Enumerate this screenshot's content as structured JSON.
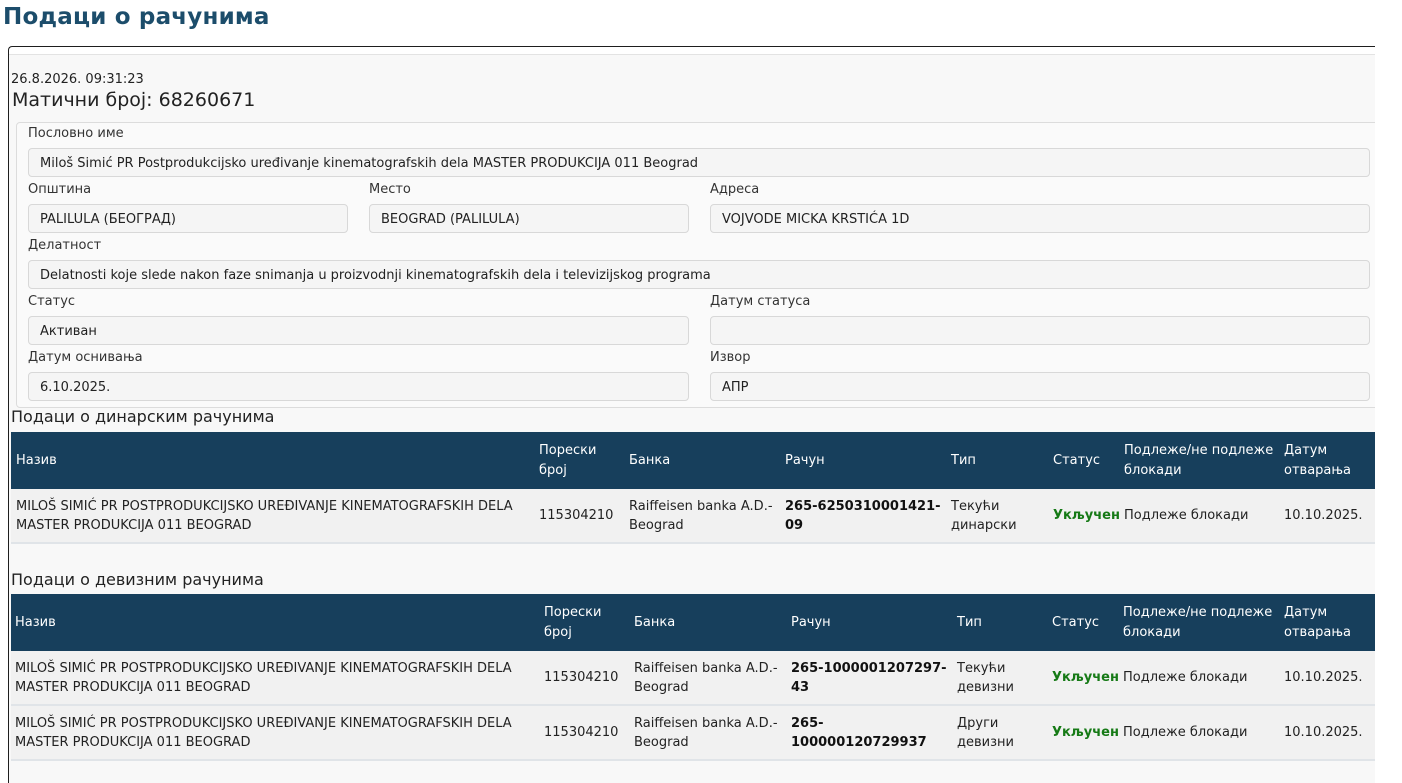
{
  "page": {
    "title": "Подаци о рачунима"
  },
  "meta": {
    "timestamp": "26.8.2026. 09:31:23",
    "maticni_label": "Матични број:",
    "maticni_value": "68260671"
  },
  "form": {
    "poslovno_ime_label": "Пословно име",
    "poslovno_ime": "Miloš Simić PR Postprodukcijsko uređivanje kinematografskih dela MASTER PRODUKCIJA 011 Beograd",
    "opstina_label": "Општина",
    "opstina": "PALILULA (БЕОГРАД)",
    "mesto_label": "Место",
    "mesto": "BEOGRAD (PALILULA)",
    "adresa_label": "Адреса",
    "adresa": "VOJVODE MICKA KRSTIĆA 1D",
    "delatnost_label": "Делатност",
    "delatnost": "Delatnosti koje slede nakon faze snimanja u proizvodnji kinematografskih dela i televizijskog programa",
    "status_label": "Статус",
    "status": "Активан",
    "datum_statusa_label": "Датум статуса",
    "datum_statusa": "",
    "datum_osnivanja_label": "Датум оснивања",
    "datum_osnivanja": "6.10.2025.",
    "izvor_label": "Извор",
    "izvor": "АПР"
  },
  "dinarski": {
    "title": "Подаци о динарским рачунима",
    "headers": [
      "Назив",
      "Порески број",
      "Банка",
      "Рачун",
      "Тип",
      "Статус",
      "Подлеже/не подлеже блокади",
      "Датум отварања"
    ],
    "rows": [
      {
        "naziv": "MILOŠ SIMIĆ PR POSTPRODUKCIJSKO UREĐIVANJE KINEMATOGRAFSKIH DELA MASTER PRODUKCIJA 011 BEOGRAD",
        "pib": "115304210",
        "banka": "Raiffeisen banka A.D.-Beograd",
        "racun": "265-6250310001421-09",
        "tip": "Текући динарски",
        "status": "Укључен",
        "blokada": "Подлеже блокади",
        "datum": "10.10.2025."
      }
    ]
  },
  "devizni": {
    "title": "Подаци о девизним рачунима",
    "headers": [
      "Назив",
      "Порески број",
      "Банка",
      "Рачун",
      "Тип",
      "Статус",
      "Подлеже/не подлеже блокади",
      "Датум отварања"
    ],
    "rows": [
      {
        "naziv": "MILOŠ SIMIĆ PR POSTPRODUKCIJSKO UREĐIVANJE KINEMATOGRAFSKIH DELA MASTER PRODUKCIJA 011 BEOGRAD",
        "pib": "115304210",
        "banka": "Raiffeisen banka A.D.-Beograd",
        "racun": "265-1000001207297-43",
        "tip": "Текући девизни",
        "status": "Укључен",
        "blokada": "Подлеже блокади",
        "datum": "10.10.2025."
      },
      {
        "naziv": "MILOŠ SIMIĆ PR POSTPRODUKCIJSKO UREĐIVANJE KINEMATOGRAFSKIH DELA MASTER PRODUKCIJA 011 BEOGRAD",
        "pib": "115304210",
        "banka": "Raiffeisen banka A.D.-Beograd",
        "racun": "265-100000120729937",
        "tip": "Други девизни",
        "status": "Укључен",
        "blokada": "Подлеже блокади",
        "datum": "10.10.2025."
      }
    ]
  },
  "colors": {
    "title": "#1c4d6b",
    "table_header": "#173f5c",
    "status_active": "#167a16"
  }
}
